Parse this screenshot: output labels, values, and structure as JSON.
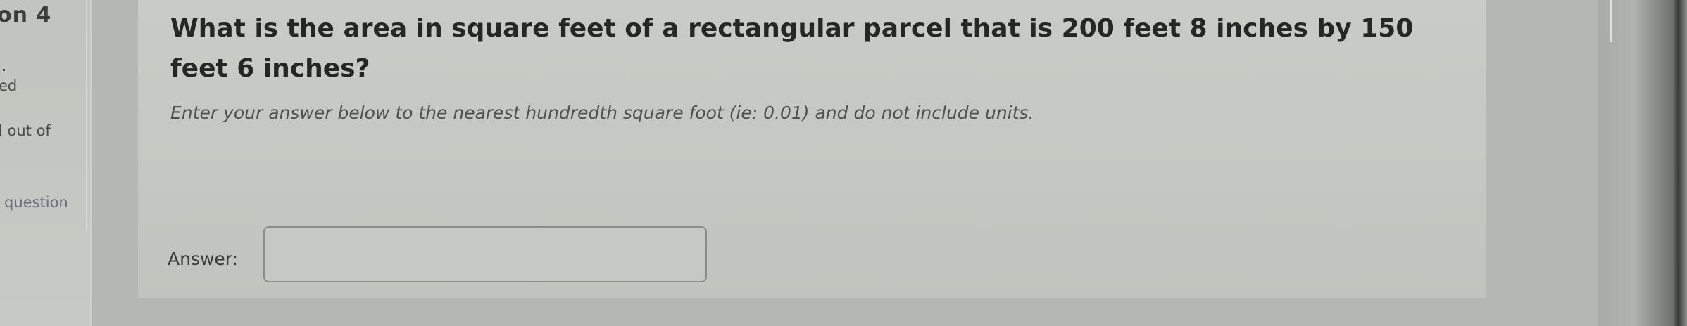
{
  "sidebar": {
    "question_number": "on 4",
    "status": "ed",
    "marks": "l out of",
    "flag": "question"
  },
  "question": {
    "text": "What is the area in square feet of a rectangular parcel that is 200 feet 8 inches by 150 feet 6 inches?",
    "instructions": "Enter your answer below to the nearest hundredth square foot (ie: 0.01) and do not include units."
  },
  "answer": {
    "label": "Answer:",
    "value": ""
  }
}
